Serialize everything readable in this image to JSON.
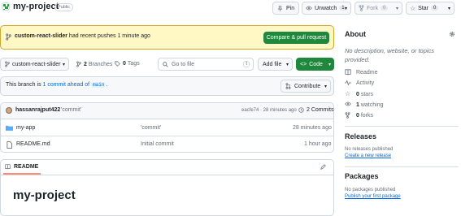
{
  "repo": {
    "name": "my-project",
    "visibility": "Public"
  },
  "actions": {
    "pin": "Pin",
    "unwatch": "Unwatch",
    "watch_count": "1",
    "fork": "Fork",
    "fork_count": "0",
    "star": "Star",
    "star_count": "0"
  },
  "banner": {
    "branch": "custom-react-slider",
    "message": "had recent pushes 1 minute ago",
    "button": "Compare & pull request"
  },
  "toolbar": {
    "branch": "custom-react-slider",
    "branches_count": "2",
    "branches_label": "Branches",
    "tags_count": "0",
    "tags_label": "Tags",
    "goto_placeholder": "Go to file",
    "goto_key": "t",
    "add_file": "Add file",
    "code": "Code"
  },
  "ahead": {
    "prefix": "This branch is",
    "link": "1 commit ahead of",
    "base": "main",
    "suffix": ".",
    "contribute": "Contribute"
  },
  "commit": {
    "author": "hassanrajput422",
    "message": "'commit'",
    "meta": "eacfe74 · 28 minutes ago",
    "count": "2 Commits"
  },
  "files": [
    {
      "name": "my-app",
      "type": "folder",
      "message": "'commit'",
      "time": "28 minutes ago"
    },
    {
      "name": "README.md",
      "type": "file",
      "message": "Initial commit",
      "time": "1 hour ago"
    }
  ],
  "readme": {
    "tab": "README",
    "heading": "my-project"
  },
  "about": {
    "title": "About",
    "description": "No description, website, or topics provided.",
    "items": [
      {
        "icon": "book-icon",
        "label": "Readme"
      },
      {
        "icon": "pulse-icon",
        "label": "Activity"
      },
      {
        "icon": "star-icon",
        "count": "0",
        "label": "stars"
      },
      {
        "icon": "eye-icon",
        "count": "1",
        "label": "watching"
      },
      {
        "icon": "fork-icon",
        "count": "0",
        "label": "forks"
      }
    ]
  },
  "releases": {
    "title": "Releases",
    "none": "No releases published",
    "link": "Create a new release"
  },
  "packages": {
    "title": "Packages",
    "none": "No packages published",
    "link": "Publish your first package"
  },
  "colors": {
    "accent": "#0969da",
    "green": "#1f883d",
    "banner_bg": "#fff8c5",
    "banner_border": "#d4a72c"
  }
}
